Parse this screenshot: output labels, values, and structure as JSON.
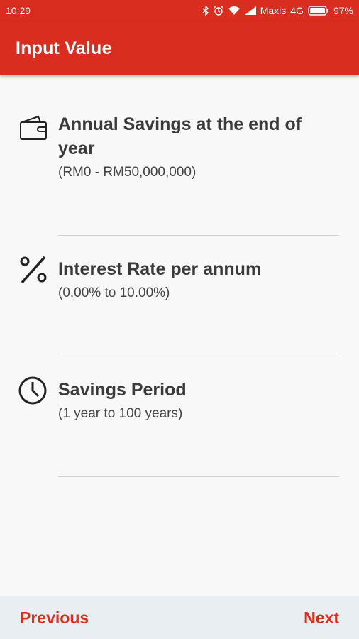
{
  "status_bar": {
    "time": "10:29",
    "carrier": "Maxis",
    "network": "4G",
    "battery": "97%",
    "icons": [
      "bluetooth-icon",
      "alarm-icon",
      "wifi-icon",
      "signal-icon",
      "battery-icon"
    ]
  },
  "app_bar": {
    "title": "Input Value",
    "color": "#d92d20"
  },
  "fields": [
    {
      "icon": "wallet-icon",
      "title": "Annual Savings at the end of year",
      "range": "(RM0 - RM50,000,000)",
      "value": ""
    },
    {
      "icon": "percent-icon",
      "title": "Interest Rate per annum",
      "range": "(0.00% to 10.00%)",
      "value": ""
    },
    {
      "icon": "clock-icon",
      "title": "Savings Period",
      "range": "(1 year to 100 years)",
      "value": ""
    }
  ],
  "footer": {
    "previous_label": "Previous",
    "next_label": "Next"
  }
}
